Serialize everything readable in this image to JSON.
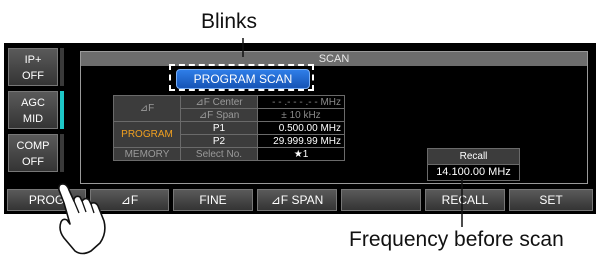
{
  "callouts": {
    "blinks": "Blinks",
    "frequency_before_scan": "Frequency before scan"
  },
  "side_buttons": [
    {
      "line1": "IP+",
      "line2": "OFF"
    },
    {
      "line1": "AGC",
      "line2": "MID"
    },
    {
      "line1": "COMP",
      "line2": "OFF"
    }
  ],
  "panel": {
    "title": "SCAN",
    "status_badge": "PROGRAM SCAN",
    "delta_f_group": "⊿F",
    "delta_f_center_label": "⊿F Center",
    "delta_f_center_value": "- - .- - - .- -  MHz",
    "delta_f_span_label": "⊿F Span",
    "delta_f_span_value": "±  10  kHz",
    "program_group": "PROGRAM",
    "p1_label": "P1",
    "p1_value": "0.500.00 MHz",
    "p2_label": "P2",
    "p2_value": "29.999.99 MHz",
    "memory_group": "MEMORY",
    "memory_label": "Select No.",
    "memory_value": "★1",
    "recall_label": "Recall",
    "recall_value": "14.100.00 MHz"
  },
  "bottom_buttons": [
    "PROG",
    "⊿F",
    "FINE",
    "⊿F SPAN",
    "",
    "RECALL",
    "SET"
  ],
  "colors": {
    "accent_blue": "#1f6fd8",
    "program_orange": "#f0a020",
    "screen_bg": "#000000"
  },
  "icons": {
    "pointer": "hand-pointer-icon"
  }
}
